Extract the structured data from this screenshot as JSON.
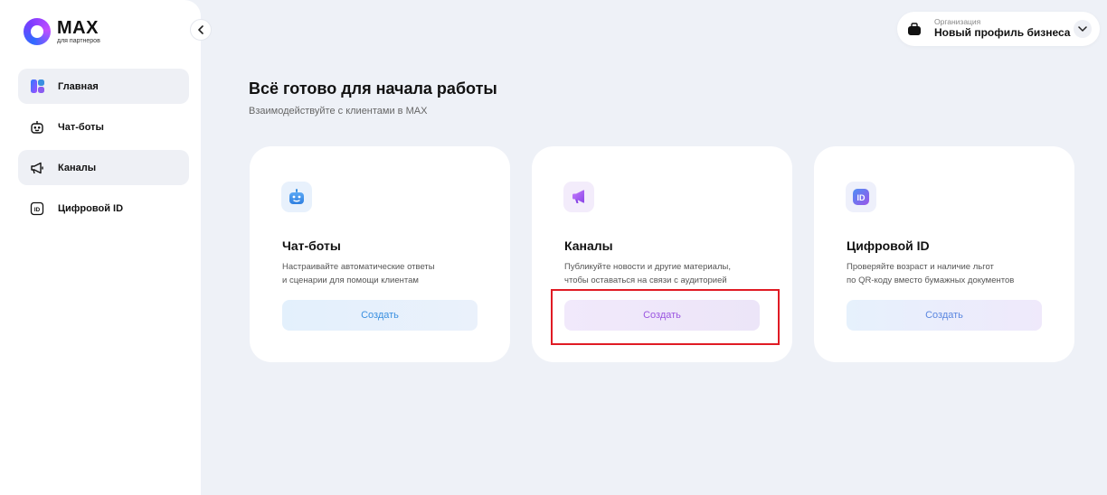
{
  "brand": {
    "title": "MAX",
    "subtitle": "для партнеров"
  },
  "sidebar": {
    "collapse_icon": "chevron-left-icon",
    "items": [
      {
        "label": "Главная",
        "icon": "home-grid-icon",
        "active": true
      },
      {
        "label": "Чат-боты",
        "icon": "robot-icon",
        "active": false
      },
      {
        "label": "Каналы",
        "icon": "megaphone-icon",
        "active": true
      },
      {
        "label": "Цифровой ID",
        "icon": "id-icon",
        "active": false
      }
    ]
  },
  "org": {
    "label": "Организация",
    "name": "Новый профиль бизнеса",
    "icon": "briefcase-icon"
  },
  "main": {
    "title": "Всё готово для начала работы",
    "subtitle": "Взаимодействуйте с клиентами в MAX",
    "cards": [
      {
        "title": "Чат-боты",
        "desc_line1": "Настраивайте автоматические ответы",
        "desc_line2": "и сценарии для помощи клиентам",
        "button": "Создать",
        "icon": "robot-icon",
        "accent": "#3a8fe0"
      },
      {
        "title": "Каналы",
        "desc_line1": "Публикуйте новости и другие материалы,",
        "desc_line2": "чтобы оставаться на связи с аудиторией",
        "button": "Создать",
        "icon": "megaphone-icon",
        "accent": "#9a55e0"
      },
      {
        "title": "Цифровой ID",
        "desc_line1": "Проверяйте возраст и наличие льгот",
        "desc_line2": "по QR-коду вместо бумажных документов",
        "button": "Создать",
        "icon": "id-icon",
        "accent": "#6b6df0"
      }
    ]
  },
  "colors": {
    "background": "#eef1f7",
    "highlight": "#e01b24"
  }
}
